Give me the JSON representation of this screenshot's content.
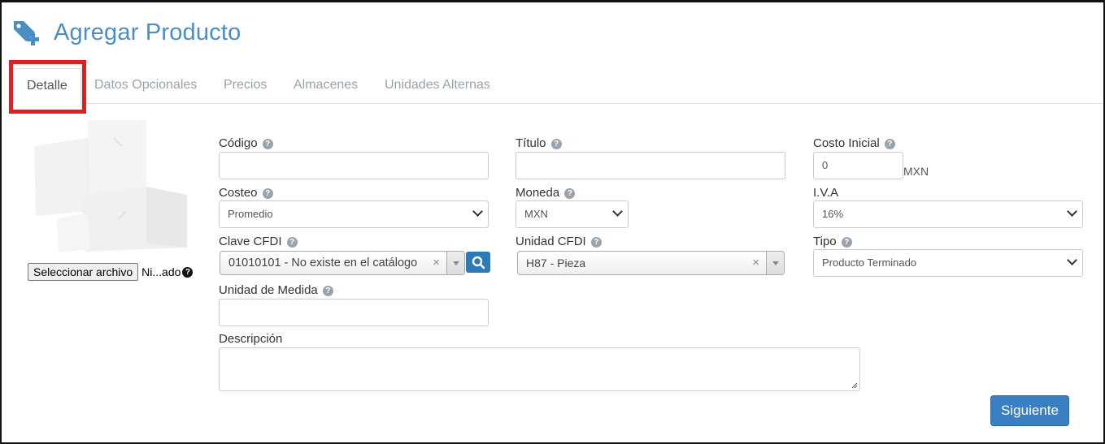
{
  "header": {
    "title": "Agregar Producto",
    "icon": "tag-plus-icon"
  },
  "tabs": [
    {
      "label": "Detalle",
      "active": true
    },
    {
      "label": "Datos Opcionales",
      "active": false
    },
    {
      "label": "Precios",
      "active": false
    },
    {
      "label": "Almacenes",
      "active": false
    },
    {
      "label": "Unidades Alternas",
      "active": false
    }
  ],
  "image": {
    "file_button": "Seleccionar archivo",
    "file_status": "Ni...ado"
  },
  "form": {
    "codigo": {
      "label": "Código",
      "value": ""
    },
    "titulo": {
      "label": "Título",
      "value": ""
    },
    "costo_inicial": {
      "label": "Costo Inicial",
      "value": "0",
      "unit": "MXN"
    },
    "costeo": {
      "label": "Costeo",
      "value": "Promedio"
    },
    "moneda": {
      "label": "Moneda",
      "value": "MXN"
    },
    "iva": {
      "label": "I.V.A",
      "value": "16%"
    },
    "clave_cfdi": {
      "label": "Clave CFDI",
      "value": "01010101 - No existe en el catálogo"
    },
    "unidad_cfdi": {
      "label": "Unidad CFDI",
      "value": "H87 - Pieza"
    },
    "tipo": {
      "label": "Tipo",
      "value": "Producto Terminado"
    },
    "unidad_medida": {
      "label": "Unidad de Medida",
      "value": ""
    },
    "descripcion": {
      "label": "Descripción",
      "value": ""
    }
  },
  "actions": {
    "next_label": "Siguiente"
  },
  "colors": {
    "accent": "#4a8ec4",
    "primary_button": "#3a7fc1",
    "highlight": "#e02020"
  }
}
